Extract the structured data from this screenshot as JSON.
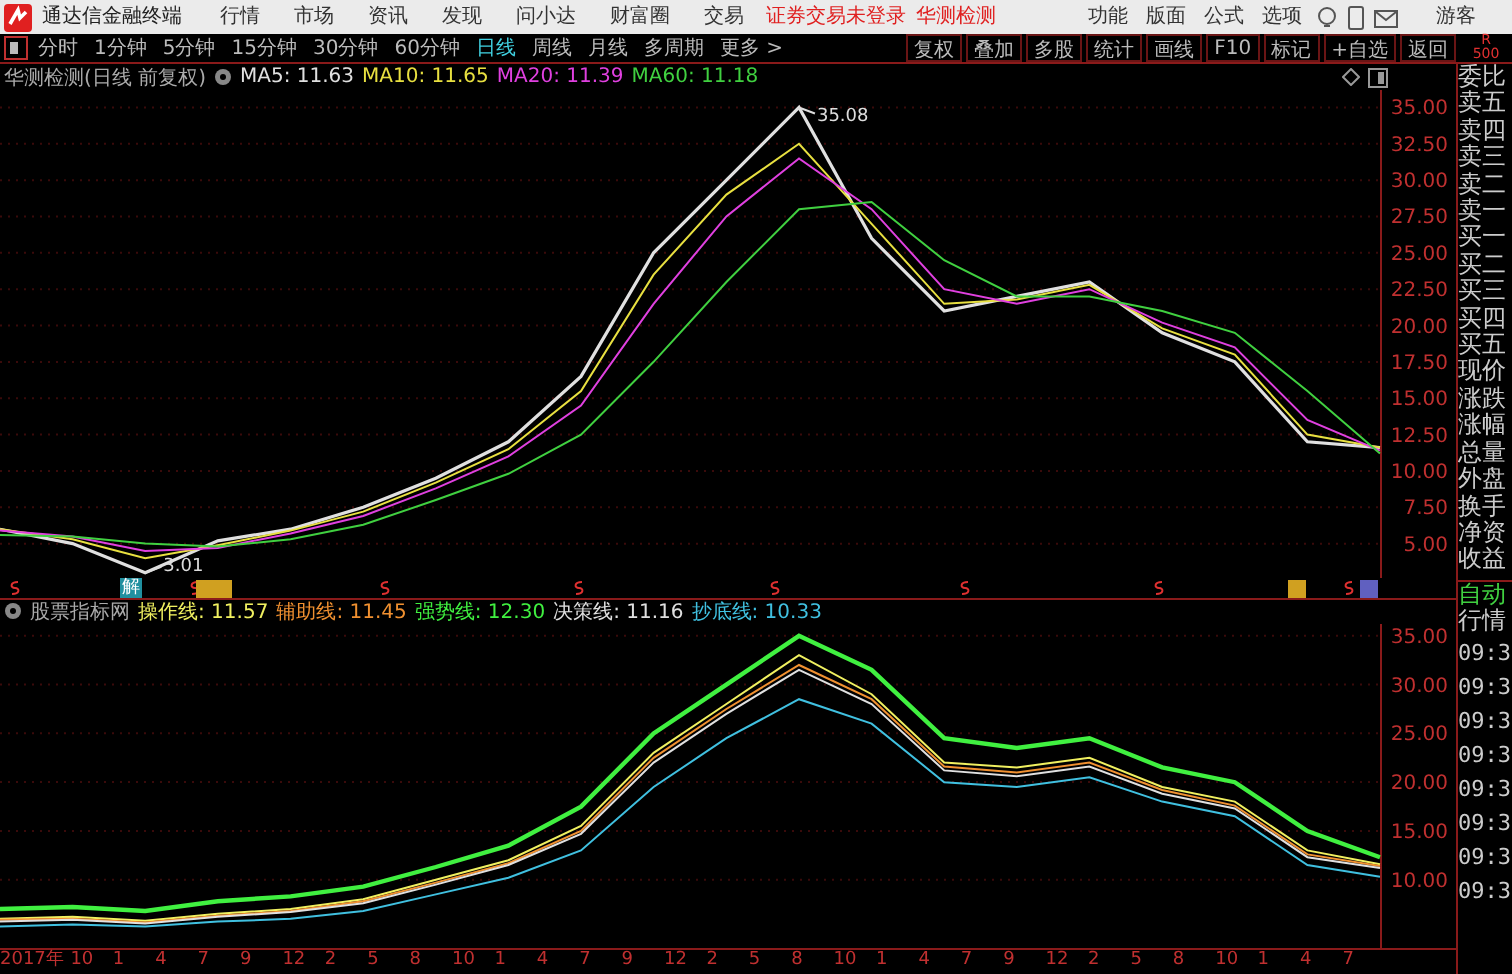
{
  "title_bar": {
    "app_name": "通达信金融终端",
    "menus": [
      "行情",
      "市场",
      "资讯",
      "发现",
      "问小达",
      "财富圈",
      "交易"
    ],
    "login_status": "证券交易未登录",
    "stock_name": "华测检测",
    "actions": [
      "功能",
      "版面",
      "公式",
      "选项"
    ],
    "user": "游客"
  },
  "period_tabs": [
    {
      "label": "分时",
      "selected": false
    },
    {
      "label": "1分钟",
      "selected": false
    },
    {
      "label": "5分钟",
      "selected": false
    },
    {
      "label": "15分钟",
      "selected": false
    },
    {
      "label": "30分钟",
      "selected": false
    },
    {
      "label": "60分钟",
      "selected": false
    },
    {
      "label": "日线",
      "selected": true
    },
    {
      "label": "周线",
      "selected": false
    },
    {
      "label": "月线",
      "selected": false
    },
    {
      "label": "多周期",
      "selected": false
    },
    {
      "label": "更多 >",
      "selected": false
    }
  ],
  "tool_buttons": [
    "复权",
    "叠加",
    "多股",
    "统计",
    "画线",
    "F10",
    "标记",
    "+自选",
    "返回"
  ],
  "corner": {
    "line_1": "R",
    "line_2": "500"
  },
  "main_chart": {
    "title": "华测检测(日线 前复权)",
    "high_label": "35.08",
    "low_label": "3.01",
    "legend": [
      {
        "name": "MA5: 11.63",
        "color": "#e0e0e0"
      },
      {
        "name": "MA10: 11.65",
        "color": "#e8e040"
      },
      {
        "name": "MA20: 11.39",
        "color": "#e040e0"
      },
      {
        "name": "MA60: 11.18",
        "color": "#40d040"
      }
    ],
    "chart_data": {
      "type": "line",
      "grid": true,
      "ylim": [
        2.5,
        36.2
      ],
      "yticks": [
        {
          "value": 35,
          "label": "35.00"
        },
        {
          "value": 32.5,
          "label": "32.50"
        },
        {
          "value": 30,
          "label": "30.00"
        },
        {
          "value": 27.5,
          "label": "27.50"
        },
        {
          "value": 25,
          "label": "25.00"
        },
        {
          "value": 22.5,
          "label": "22.50"
        },
        {
          "value": 20,
          "label": "20.00"
        },
        {
          "value": 17.5,
          "label": "17.50"
        },
        {
          "value": 15,
          "label": "15.00"
        },
        {
          "value": 12.5,
          "label": "12.50"
        },
        {
          "value": 10,
          "label": "10.00"
        },
        {
          "value": 7.5,
          "label": "7.50"
        },
        {
          "value": 5,
          "label": "5.00"
        }
      ],
      "series": [
        {
          "color": "#e0e0e0",
          "values": [
            6.0,
            5.0,
            3.0,
            5.2,
            6.0,
            7.5,
            9.5,
            12.0,
            16.5,
            25.0,
            30.0,
            35.0,
            26.0,
            21.0,
            22.0,
            23.0,
            19.5,
            17.5,
            12.0,
            11.6
          ]
        },
        {
          "color": "#e8e040",
          "values": [
            6.0,
            5.3,
            4.0,
            4.9,
            5.9,
            7.2,
            9.2,
            11.5,
            15.5,
            23.5,
            29.0,
            32.5,
            27.0,
            21.5,
            21.8,
            22.8,
            19.8,
            18.0,
            12.5,
            11.6
          ]
        },
        {
          "color": "#e040e0",
          "values": [
            5.9,
            5.5,
            4.5,
            4.7,
            5.7,
            6.9,
            8.8,
            11.0,
            14.5,
            21.5,
            27.5,
            31.5,
            28.0,
            22.5,
            21.5,
            22.5,
            20.2,
            18.5,
            13.5,
            11.4
          ]
        },
        {
          "color": "#40d040",
          "values": [
            5.6,
            5.5,
            5.0,
            4.8,
            5.3,
            6.3,
            8.0,
            9.8,
            12.5,
            17.5,
            23.0,
            28.0,
            28.5,
            24.5,
            22.0,
            22.0,
            21.0,
            19.5,
            15.5,
            11.2
          ]
        }
      ]
    }
  },
  "event_tag": "解",
  "indicator_chart": {
    "title": "股票指标网",
    "legend": [
      {
        "name": "操作线: 11.57",
        "color": "#f0f060"
      },
      {
        "name": "辅助线: 11.45",
        "color": "#f09030"
      },
      {
        "name": "强势线: 12.30",
        "color": "#40f040"
      },
      {
        "name": "决策线: 11.16",
        "color": "#e0e0e0"
      },
      {
        "name": "抄底线: 10.33",
        "color": "#40c0e0"
      }
    ],
    "chart_data": {
      "type": "line",
      "grid": true,
      "ylim": [
        2.8,
        36.2
      ],
      "yticks": [
        {
          "value": 35,
          "label": "35.00"
        },
        {
          "value": 30,
          "label": "30.00"
        },
        {
          "value": 25,
          "label": "25.00"
        },
        {
          "value": 20,
          "label": "20.00"
        },
        {
          "value": 15,
          "label": "15.00"
        },
        {
          "value": 10,
          "label": "10.00"
        }
      ],
      "series": [
        {
          "color": "#f0f060",
          "values": [
            6.0,
            6.2,
            5.8,
            6.5,
            7.0,
            8.0,
            10.0,
            12.0,
            15.5,
            23.0,
            28.0,
            33.0,
            29.0,
            22.0,
            21.5,
            22.5,
            19.5,
            18.0,
            13.0,
            11.6
          ]
        },
        {
          "color": "#f09030",
          "values": [
            5.9,
            6.0,
            5.6,
            6.3,
            6.8,
            7.8,
            9.7,
            11.7,
            15.0,
            22.5,
            27.5,
            32.0,
            28.5,
            21.6,
            21.0,
            22.0,
            19.2,
            17.6,
            12.6,
            11.4
          ]
        },
        {
          "color": "#40f040",
          "values": [
            7.0,
            7.2,
            6.8,
            7.8,
            8.3,
            9.3,
            11.3,
            13.5,
            17.5,
            25.0,
            30.0,
            35.0,
            31.5,
            24.5,
            23.5,
            24.5,
            21.5,
            20.0,
            15.0,
            12.3
          ]
        },
        {
          "color": "#e0e0e0",
          "values": [
            5.7,
            5.9,
            5.5,
            6.2,
            6.7,
            7.6,
            9.5,
            11.5,
            14.7,
            22.0,
            27.0,
            31.5,
            28.0,
            21.2,
            20.6,
            21.6,
            18.8,
            17.3,
            12.3,
            11.2
          ]
        },
        {
          "color": "#40c0e0",
          "values": [
            5.2,
            5.4,
            5.2,
            5.7,
            6.0,
            6.8,
            8.5,
            10.2,
            13.0,
            19.5,
            24.5,
            28.5,
            26.0,
            20.0,
            19.5,
            20.5,
            18.0,
            16.5,
            11.5,
            10.3
          ]
        }
      ]
    }
  },
  "x_axis": [
    "2017年",
    "10",
    "1",
    "4",
    "7",
    "9",
    "12",
    "2",
    "5",
    "8",
    "10",
    "1",
    "4",
    "7",
    "9",
    "12",
    "2",
    "5",
    "8",
    "10",
    "1",
    "4",
    "7",
    "9",
    "12",
    "2",
    "5",
    "8",
    "10",
    "1",
    "4",
    "7"
  ],
  "quote_labels": [
    "委比",
    "卖五",
    "卖四",
    "卖三",
    "卖二",
    "卖一",
    "买一",
    "买二",
    "买三",
    "买四",
    "买五",
    "现价",
    "涨跌",
    "涨幅",
    "总量",
    "外盘",
    "换手",
    "净资",
    "收益"
  ],
  "side_panel": {
    "mode": "自动",
    "label": "行情",
    "times": [
      "09:3",
      "09:3",
      "09:3",
      "09:3",
      "09:3",
      "09:3",
      "09:3",
      "09:3"
    ]
  }
}
